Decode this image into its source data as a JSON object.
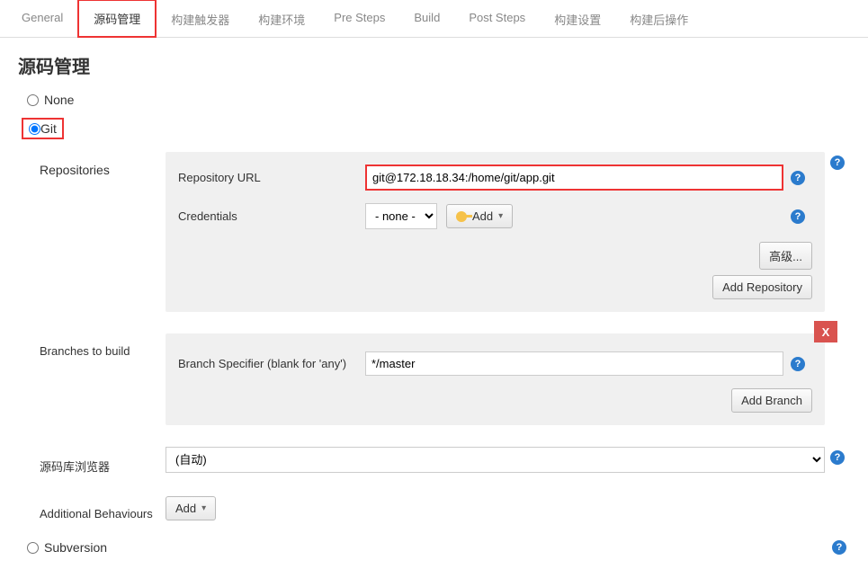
{
  "tabs": {
    "general": "General",
    "scm": "源码管理",
    "triggers": "构建触发器",
    "env": "构建环境",
    "pre": "Pre Steps",
    "build": "Build",
    "post": "Post Steps",
    "settings": "构建设置",
    "postbuild": "构建后操作"
  },
  "section": {
    "title": "源码管理",
    "none_label": "None",
    "git_label": "Git",
    "subversion_label": "Subversion"
  },
  "repos": {
    "label": "Repositories",
    "url_label": "Repository URL",
    "url_value": "git@172.18.18.34:/home/git/app.git",
    "cred_label": "Credentials",
    "cred_value": "- none -",
    "add_button": "Add",
    "advanced_button": "高级...",
    "add_repo_button": "Add Repository"
  },
  "branches": {
    "label": "Branches to build",
    "spec_label": "Branch Specifier (blank for 'any')",
    "spec_value": "*/master",
    "add_branch_button": "Add Branch",
    "close_label": "X"
  },
  "browser": {
    "label": "源码库浏览器",
    "value": "(自动)"
  },
  "behaviours": {
    "label": "Additional Behaviours",
    "add_button": "Add"
  }
}
